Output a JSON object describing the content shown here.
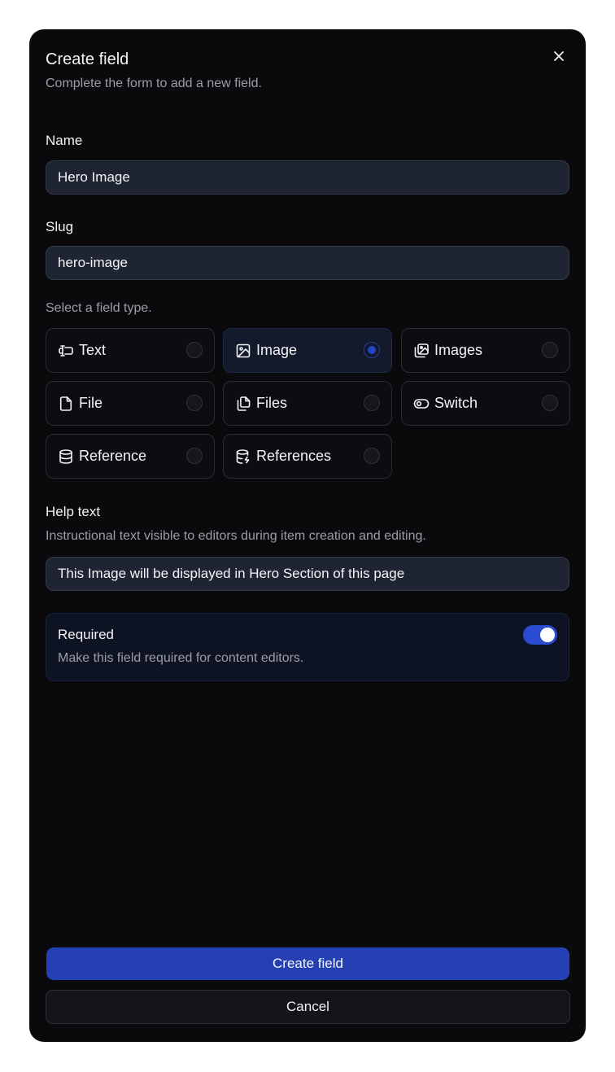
{
  "dialog": {
    "title": "Create field",
    "subtitle": "Complete the form to add a new field."
  },
  "name_field": {
    "label": "Name",
    "value": "Hero Image"
  },
  "slug_field": {
    "label": "Slug",
    "value": "hero-image"
  },
  "field_type": {
    "prompt": "Select a field type.",
    "selected": "Image",
    "options": [
      {
        "label": "Text",
        "icon": "text-cursor-input-icon"
      },
      {
        "label": "Image",
        "icon": "image-icon"
      },
      {
        "label": "Images",
        "icon": "images-icon"
      },
      {
        "label": "File",
        "icon": "file-icon"
      },
      {
        "label": "Files",
        "icon": "files-icon"
      },
      {
        "label": "Switch",
        "icon": "toggle-icon"
      },
      {
        "label": "Reference",
        "icon": "database-icon"
      },
      {
        "label": "References",
        "icon": "database-zap-icon"
      }
    ]
  },
  "help_text": {
    "label": "Help text",
    "description": "Instructional text visible to editors during item creation and editing.",
    "value": "This Image will be displayed in Hero Section of this page"
  },
  "required": {
    "title": "Required",
    "description": "Make this field required for content editors.",
    "enabled": true
  },
  "actions": {
    "create_label": "Create field",
    "cancel_label": "Cancel"
  },
  "colors": {
    "dialog_bg": "#0a0a0c",
    "accent": "#2440b2",
    "input_bg": "#1e2431"
  }
}
